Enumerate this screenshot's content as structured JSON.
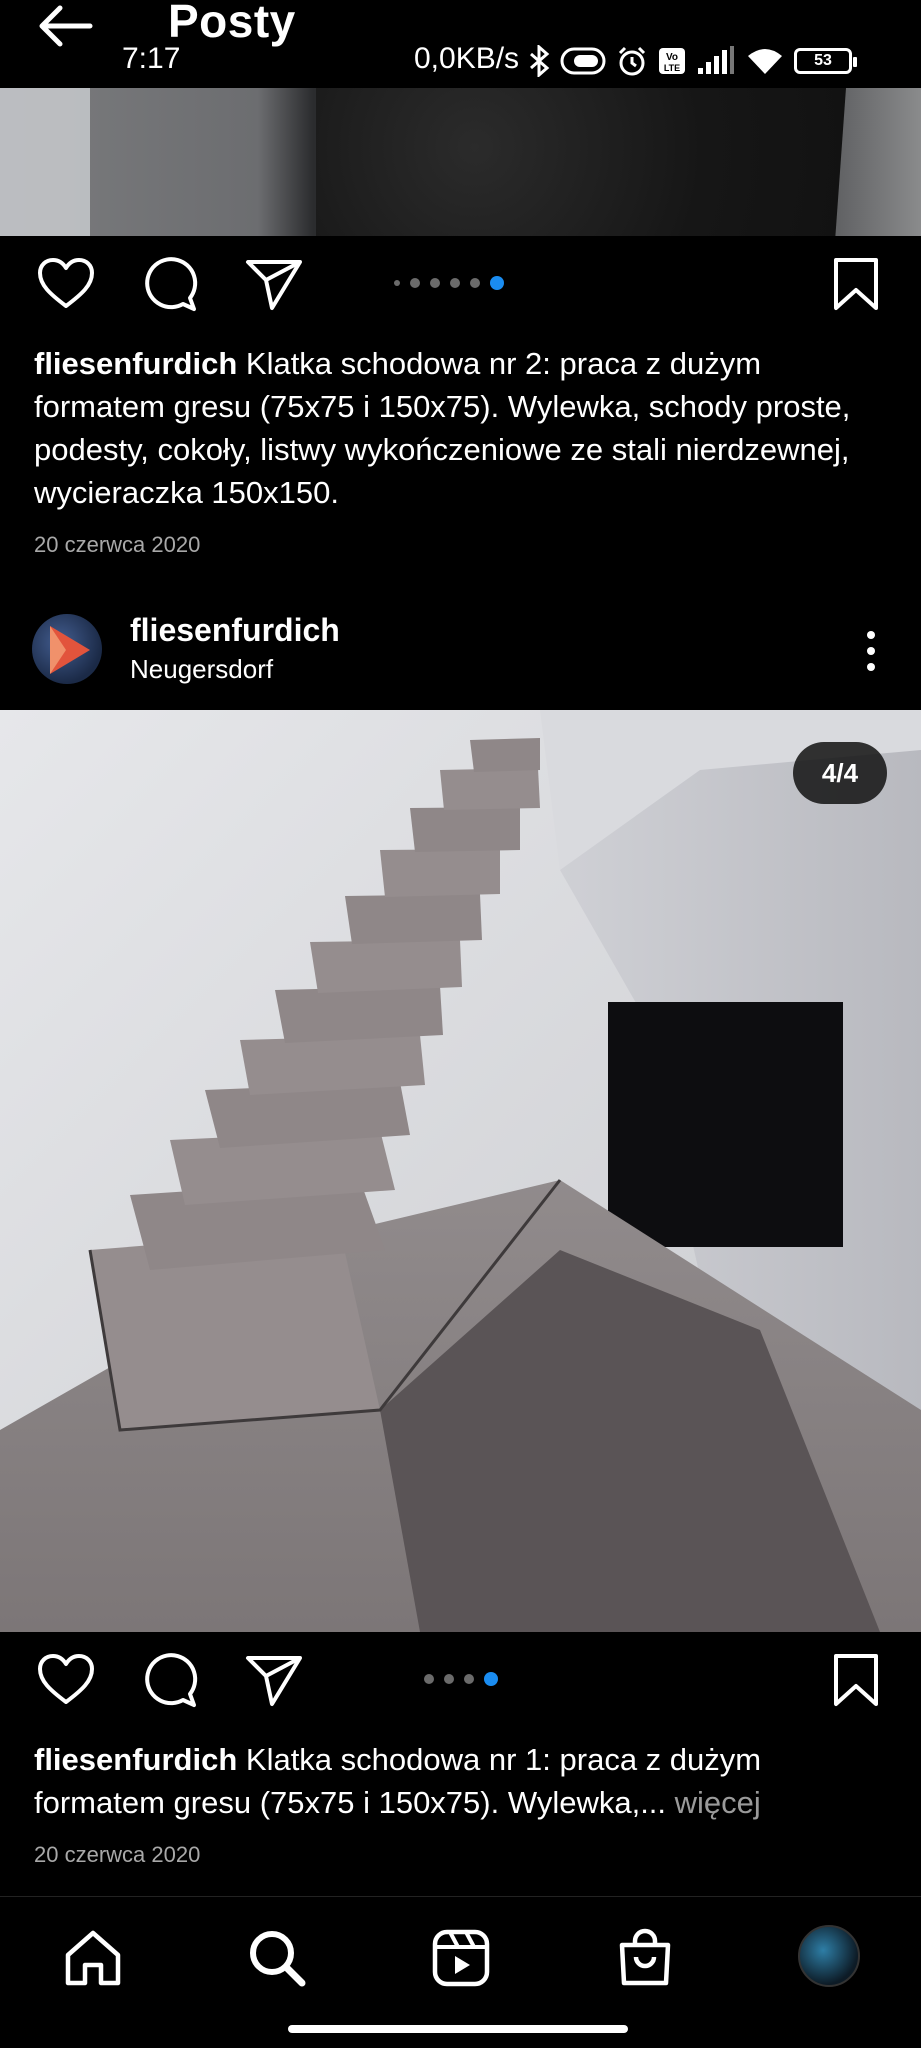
{
  "header": {
    "title": "Posty",
    "back_icon": "arrow-left-icon"
  },
  "status_bar": {
    "time": "7:17",
    "network_speed": "0,0KB/s",
    "battery": "53",
    "icons": [
      "bluetooth-icon",
      "toggle-icon",
      "alarm-icon",
      "volte-icon",
      "signal-icon",
      "wifi-icon",
      "battery-icon"
    ]
  },
  "post1": {
    "carousel": {
      "total": 6,
      "active_index": 6
    },
    "caption_user": "fliesenfurdich",
    "caption_text": "Klatka schodowa nr 2: praca z dużym formatem gresu (75x75 i 150x75). Wylewka, schody proste, podesty, cokoły, listwy wykończeniowe ze stali nierdzewnej, wycieraczka 150x150.",
    "date": "20 czerwca 2020"
  },
  "post2": {
    "username": "fliesenfurdich",
    "location": "Neugersdorf",
    "image_counter": "4/4",
    "carousel": {
      "total": 4,
      "active_index": 4
    },
    "caption_user": "fliesenfurdich",
    "caption_text": "Klatka schodowa nr 1: praca z dużym formatem gresu (75x75 i 150x75). Wylewka,...",
    "more_label": " więcej",
    "date": "20 czerwca 2020"
  },
  "actions": {
    "like_icon": "heart-icon",
    "comment_icon": "comment-icon",
    "share_icon": "send-icon",
    "save_icon": "bookmark-icon"
  },
  "bottom_nav": {
    "items": [
      "home-icon",
      "search-icon",
      "reels-icon",
      "shop-icon",
      "profile-avatar"
    ]
  },
  "colors": {
    "background": "#000000",
    "accent_blue": "#1a8cf0",
    "muted_text": "#a8a8a8"
  }
}
